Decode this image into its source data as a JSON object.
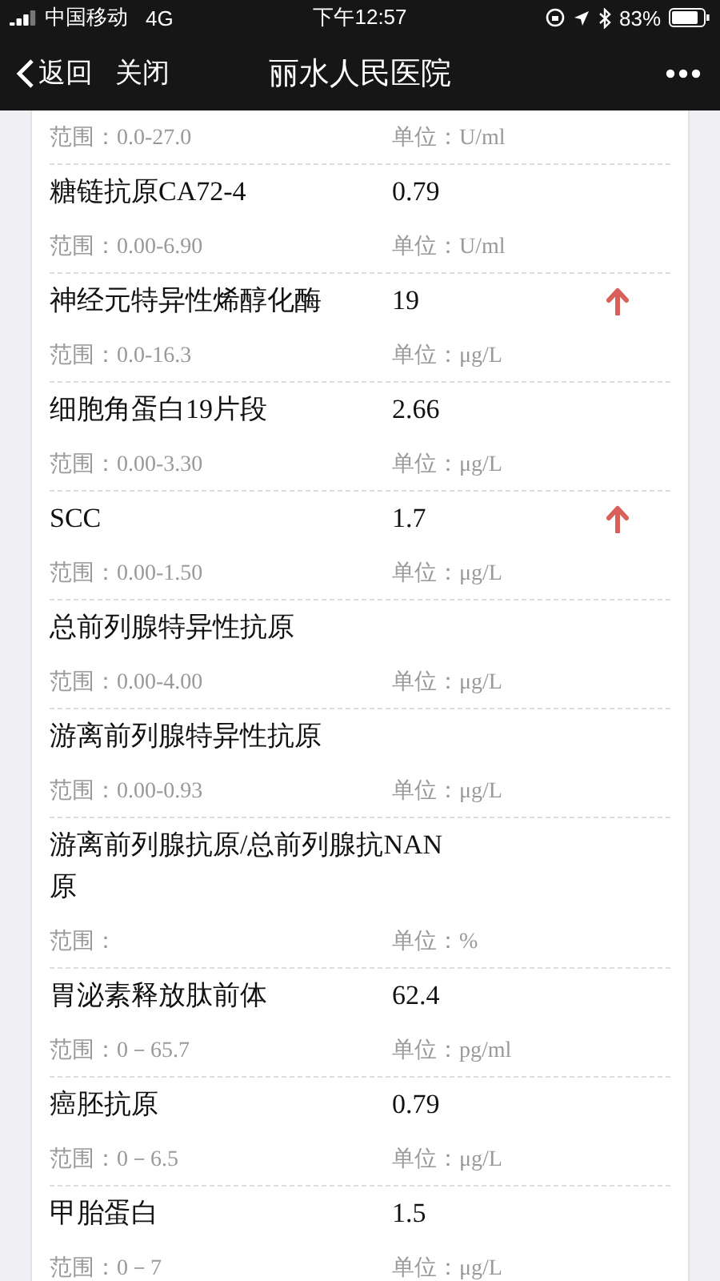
{
  "status_bar": {
    "carrier": "中国移动",
    "network": "4G",
    "time": "下午12:57",
    "battery": "83%"
  },
  "nav": {
    "back": "返回",
    "close": "关闭",
    "title": "丽水人民医院"
  },
  "results": [
    {
      "range_label": "范围：",
      "range": "0.0-27.0",
      "unit_label": "单位：",
      "unit": "U/ml",
      "high": false
    },
    {
      "name": "糖链抗原CA72-4",
      "value": "0.79",
      "range_label": "范围：",
      "range": "0.00-6.90",
      "unit_label": "单位：",
      "unit": "U/ml",
      "high": false
    },
    {
      "name": "神经元特异性烯醇化酶",
      "value": "19",
      "range_label": "范围：",
      "range": "0.0-16.3",
      "unit_label": "单位：",
      "unit": "μg/L",
      "high": true
    },
    {
      "name": "细胞角蛋白19片段",
      "value": "2.66",
      "range_label": "范围：",
      "range": "0.00-3.30",
      "unit_label": "单位：",
      "unit": "μg/L",
      "high": false
    },
    {
      "name": "SCC",
      "value": "1.7",
      "range_label": "范围：",
      "range": "0.00-1.50",
      "unit_label": "单位：",
      "unit": "μg/L",
      "high": true
    },
    {
      "name": "总前列腺特异性抗原",
      "range_label": "范围：",
      "range": "0.00-4.00",
      "unit_label": "单位：",
      "unit": "μg/L",
      "high": false
    },
    {
      "name": "游离前列腺特异性抗原",
      "range_label": "范围：",
      "range": "0.00-0.93",
      "unit_label": "单位：",
      "unit": "μg/L",
      "high": false
    },
    {
      "name": "游离前列腺抗原/总前列腺抗NAN原",
      "range_label": "范围：",
      "unit_label": "单位：",
      "unit": "%",
      "high": false
    },
    {
      "name": "胃泌素释放肽前体",
      "value": "62.4",
      "range_label": "范围：",
      "range": "0－65.7",
      "unit_label": "单位：",
      "unit": "pg/ml",
      "high": false
    },
    {
      "name": "癌胚抗原",
      "value": "0.79",
      "range_label": "范围：",
      "range": "0－6.5",
      "unit_label": "单位：",
      "unit": "μg/L",
      "high": false
    },
    {
      "name": "甲胎蛋白",
      "value": "1.5",
      "range_label": "范围：",
      "range": "0－7",
      "unit_label": "单位：",
      "unit": "μg/L",
      "high": false
    }
  ]
}
